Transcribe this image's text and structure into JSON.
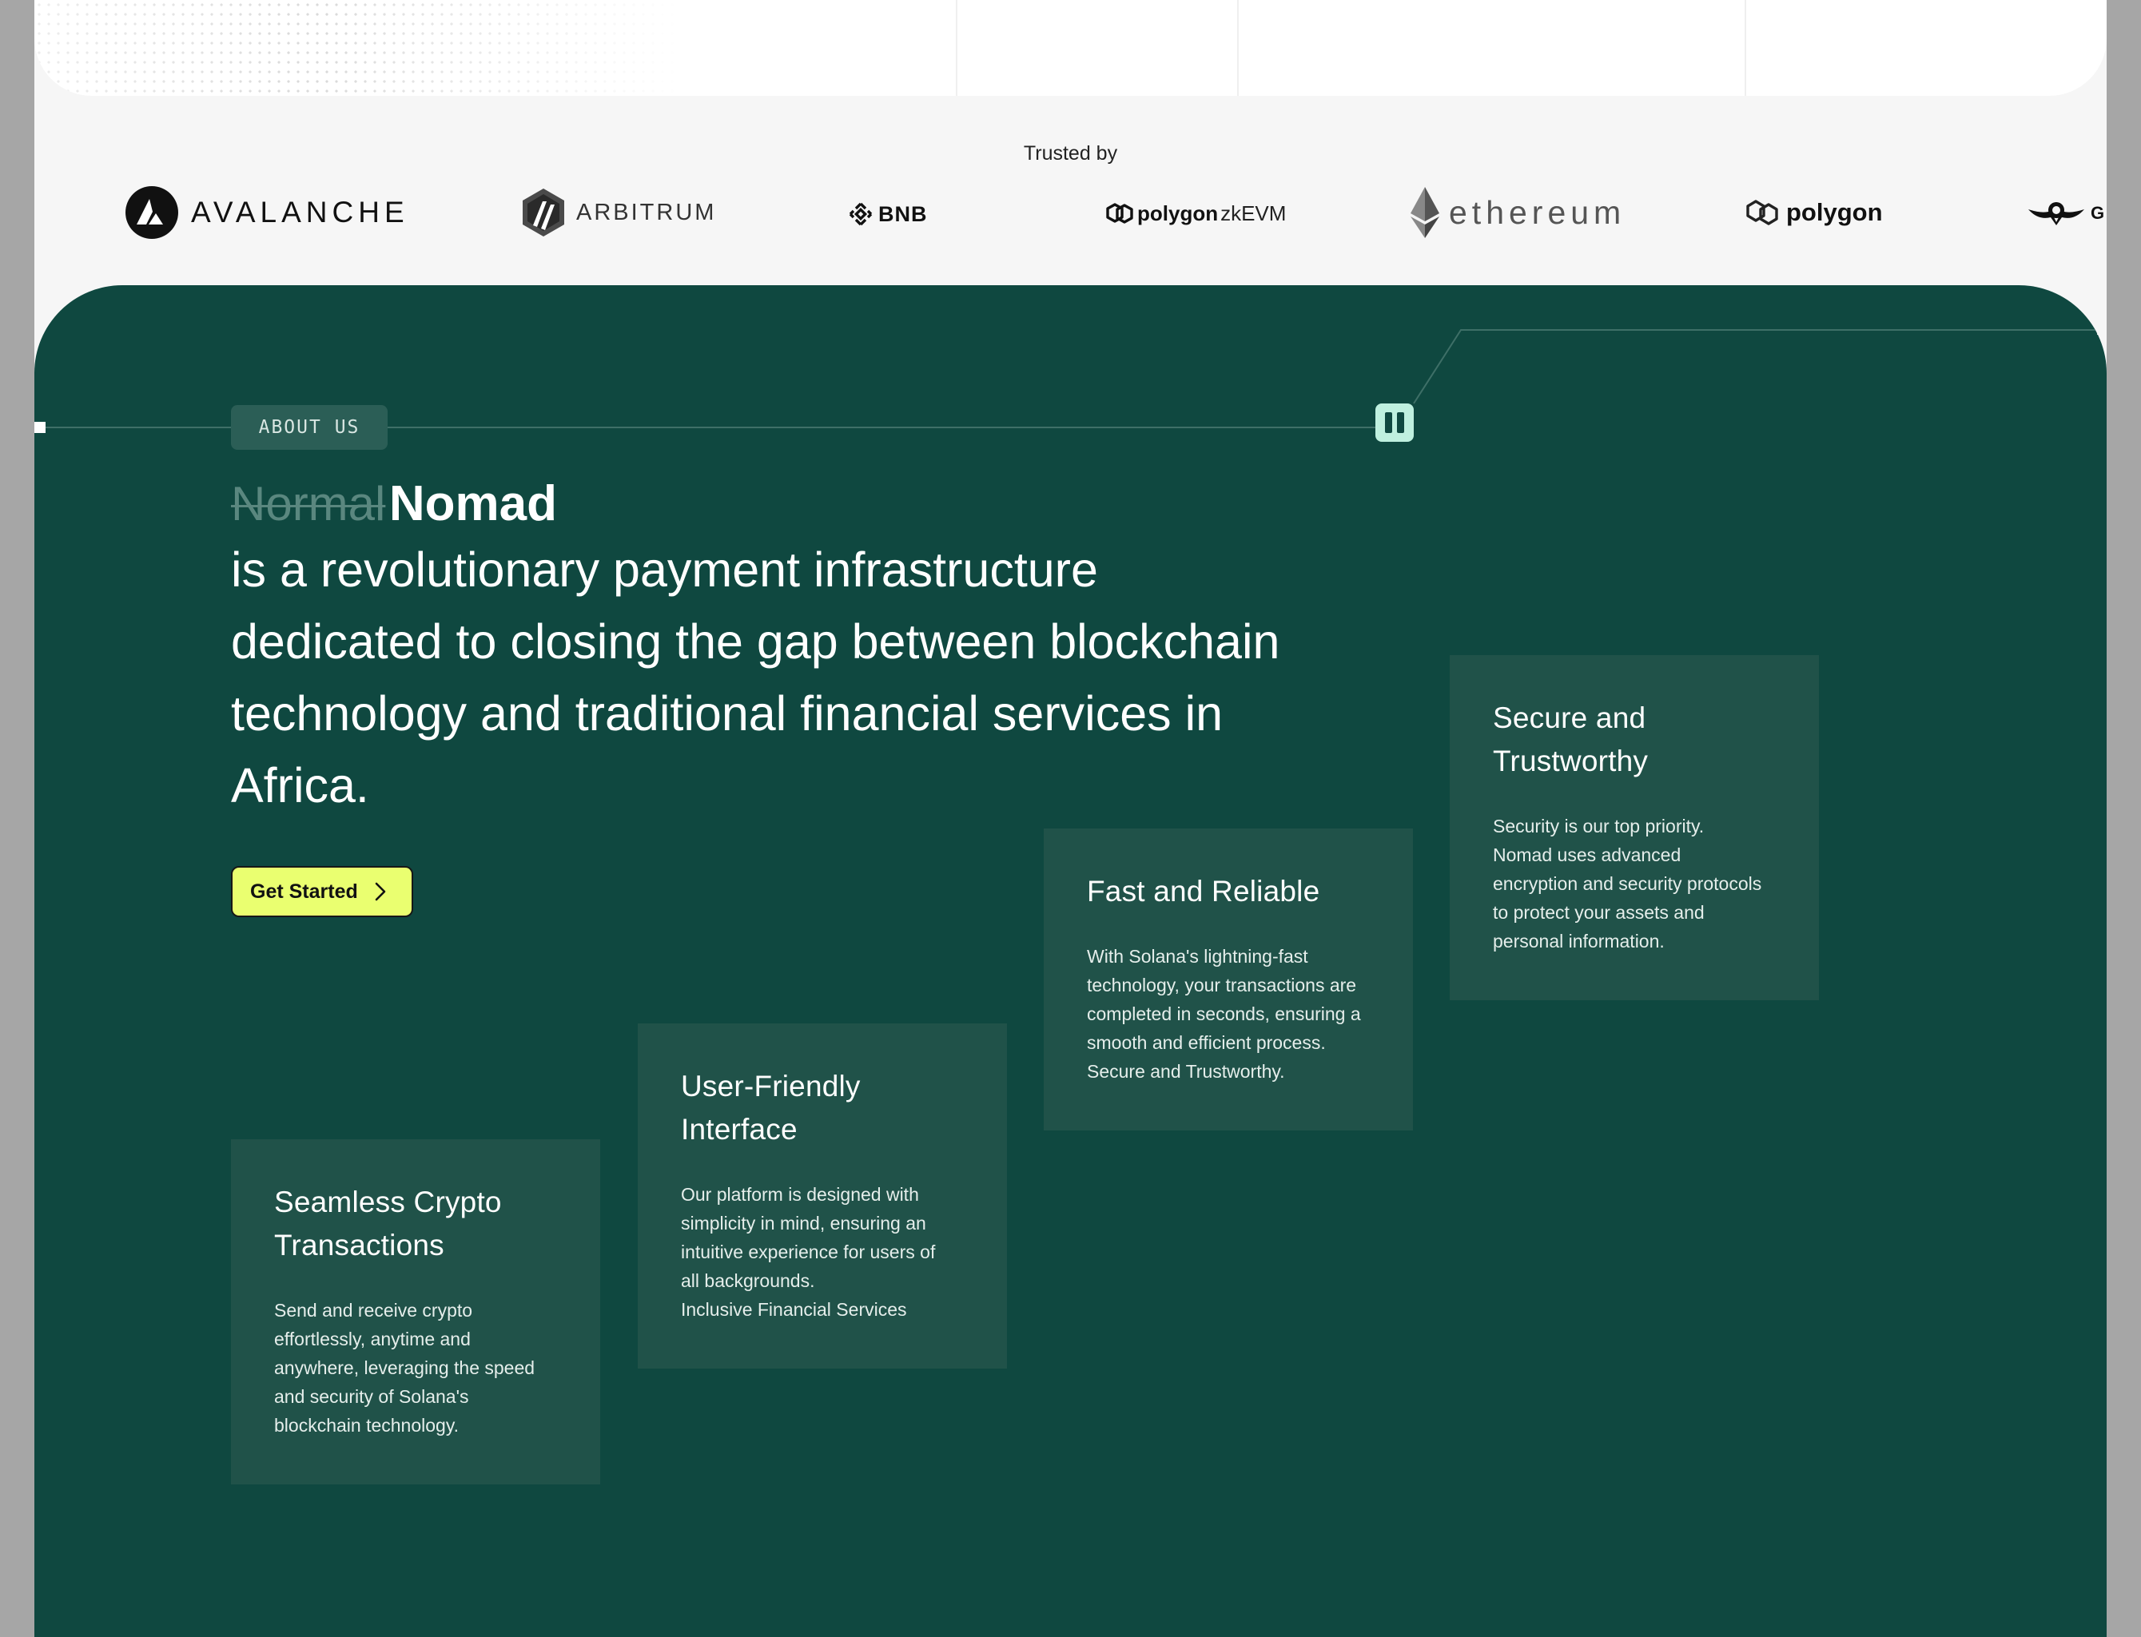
{
  "trusted": {
    "title": "Trusted by",
    "logos": [
      {
        "name": "avalanche-logo",
        "text": "AVALANCHE"
      },
      {
        "name": "arbitrum-logo",
        "text": "ARBITRUM"
      },
      {
        "name": "bnb-logo",
        "text": "BNB"
      },
      {
        "name": "polygon-zkevm-logo",
        "text": "polygon",
        "suffix": "zkEVM"
      },
      {
        "name": "ethereum-logo",
        "text": "ethereum"
      },
      {
        "name": "polygon-logo",
        "text": "polygon"
      },
      {
        "name": "gnosis-logo",
        "text": "GNOS"
      }
    ]
  },
  "about": {
    "badge": "ABOUT  US",
    "strike_word": "Normal",
    "brand": "Nomad",
    "lines": [
      "is a revolutionary payment infrastructure",
      "dedicated to closing the gap between blockchain",
      "technology and traditional financial services in",
      "Africa."
    ],
    "cta_label": "Get Started",
    "colors": {
      "background": "#0f4840",
      "card": "#205249",
      "accent": "#eaff70",
      "badge": "#2b5e56",
      "pause": "#bff0df"
    }
  },
  "features": [
    {
      "title": "Seamless Crypto\nTransactions",
      "body": "Send and receive crypto\neffortlessly, anytime and\nanywhere, leveraging the speed\nand security of Solana's\nblockchain technology."
    },
    {
      "title": "User-Friendly\nInterface",
      "body": "Our platform is designed with\nsimplicity in mind, ensuring an\nintuitive experience for users of\nall backgrounds.\nInclusive Financial Services"
    },
    {
      "title": "Fast and Reliable",
      "body": "With Solana's lightning-fast\ntechnology, your transactions are\ncompleted in seconds, ensuring a\nsmooth and efficient process.\nSecure and Trustworthy."
    },
    {
      "title": "Secure and\nTrustworthy",
      "body": "Security is our top priority.\nNomad uses advanced\nencryption and security protocols\nto protect your assets and\npersonal information."
    }
  ]
}
